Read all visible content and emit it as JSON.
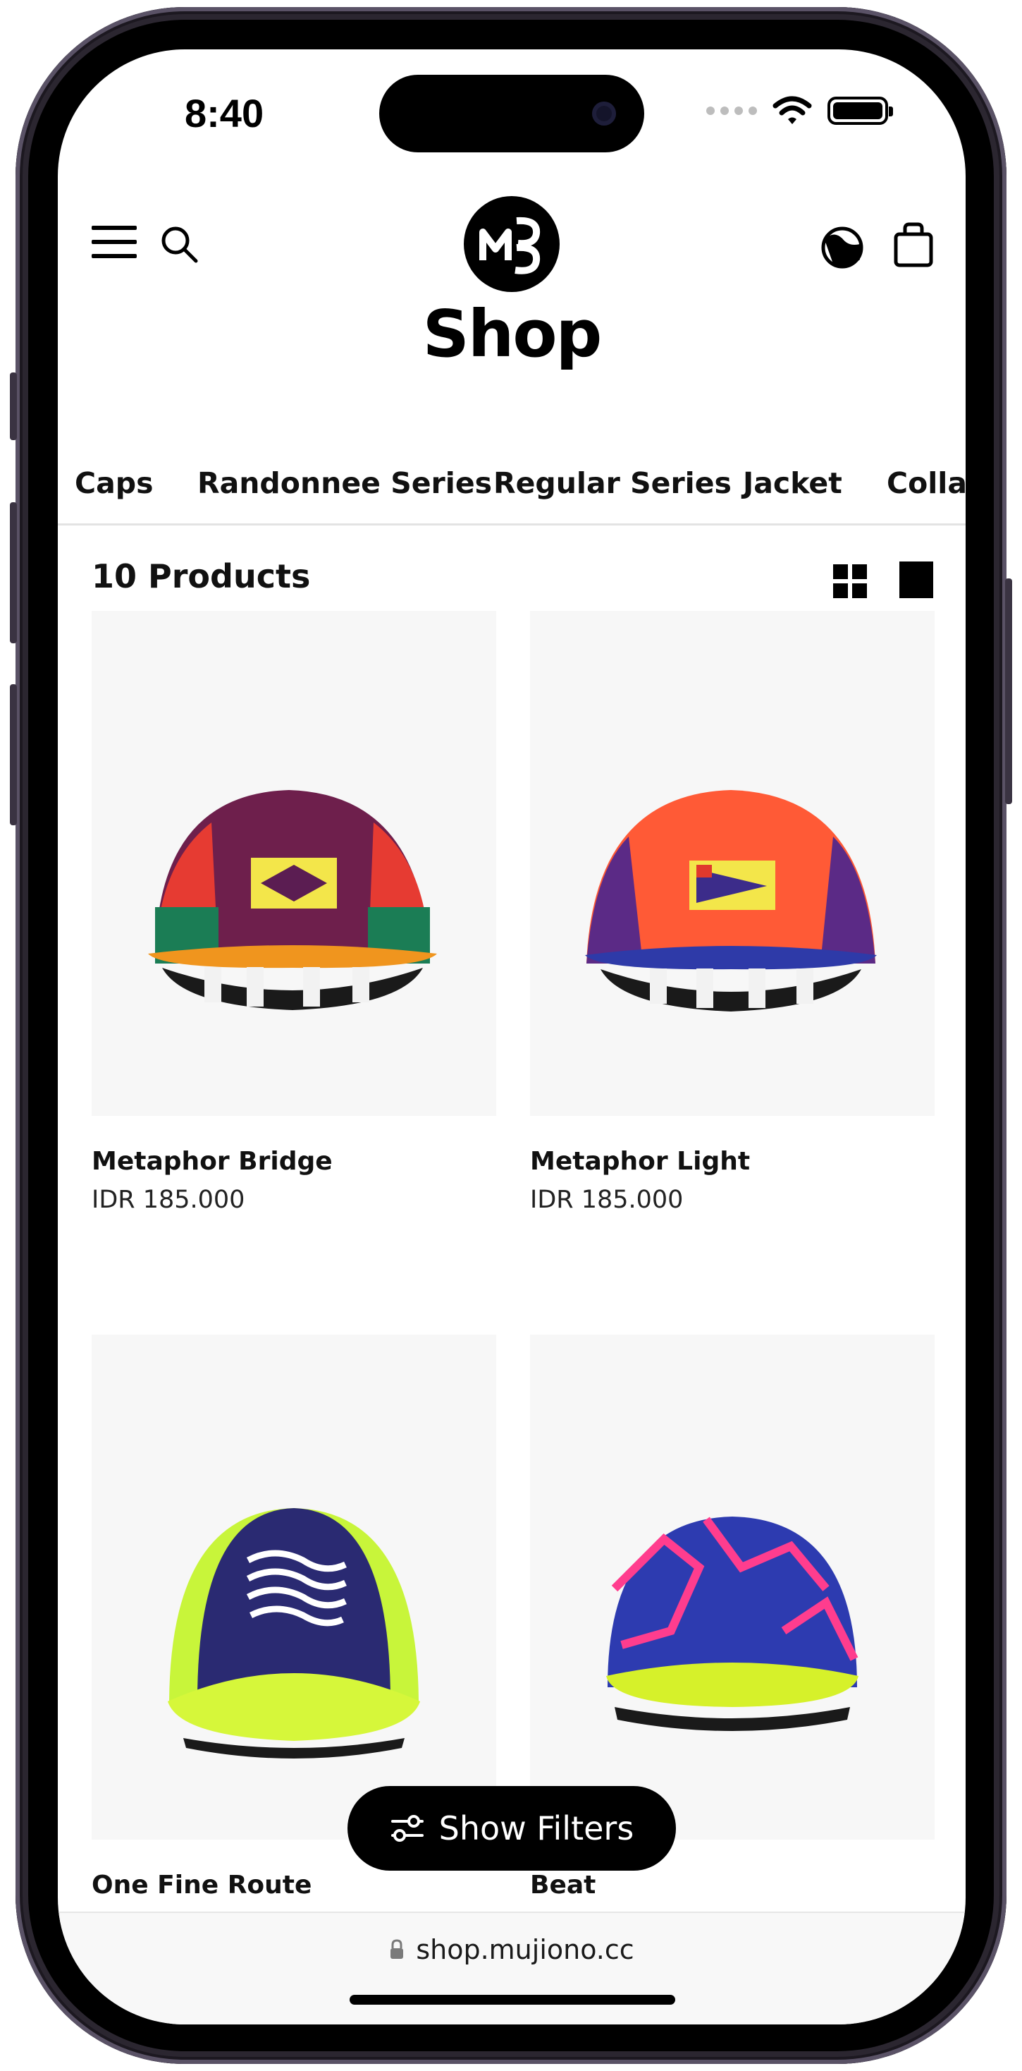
{
  "status_bar": {
    "time": "8:40"
  },
  "header": {
    "logo_text": "MC",
    "title": "Shop",
    "menu_icon": "hamburger-menu-icon",
    "search_icon": "search-icon",
    "account_icon": "user-icon",
    "bag_icon": "shopping-bag-icon"
  },
  "categories": [
    "Caps",
    "Randonnee Series",
    "Regular Series",
    "Jacket",
    "Collab"
  ],
  "listing": {
    "count_label": "10 Products"
  },
  "products": [
    {
      "name": "Metaphor Bridge",
      "price": "IDR 185.000"
    },
    {
      "name": "Metaphor Light",
      "price": "IDR 185.000"
    },
    {
      "name": "One Fine Route",
      "price": ""
    },
    {
      "name": "Beat",
      "price": ""
    }
  ],
  "filter_button": {
    "label": "Show Filters"
  },
  "browser": {
    "url": "shop.mujiono.cc"
  },
  "colors": {
    "accent": "#000000",
    "card_bg": "#f7f7f7"
  }
}
